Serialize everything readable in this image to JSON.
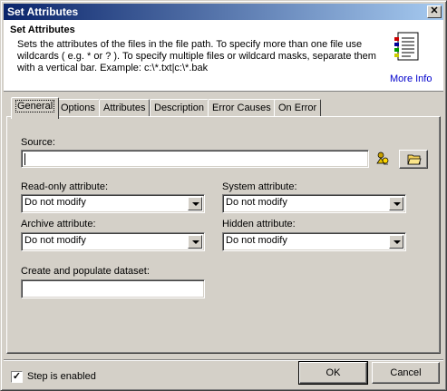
{
  "window": {
    "title": "Set Attributes",
    "close_glyph": "✕"
  },
  "header": {
    "title": "Set Attributes",
    "description": "Sets the attributes of the files in the file path. To specify more than one file use wildcards ( e.g. * or ? ). To specify multiple files or wildcard masks, separate them with a vertical bar. Example: c:\\*.txt|c:\\*.bak",
    "more_info": "More Info",
    "icon": "document-icon"
  },
  "tabs": [
    {
      "label": "General",
      "active": true
    },
    {
      "label": "Options"
    },
    {
      "label": "Attributes"
    },
    {
      "label": "Description"
    },
    {
      "label": "Error Causes"
    },
    {
      "label": "On Error"
    }
  ],
  "general": {
    "source_label": "Source:",
    "source_value": "",
    "readonly_label": "Read-only attribute:",
    "readonly_value": "Do not modify",
    "system_label": "System attribute:",
    "system_value": "Do not modify",
    "archive_label": "Archive attribute:",
    "archive_value": "Do not modify",
    "hidden_label": "Hidden attribute:",
    "hidden_value": "Do not modify",
    "dataset_label": "Create and populate dataset:",
    "dataset_value": ""
  },
  "footer": {
    "step_enabled_label": "Step is enabled",
    "step_enabled_checked": true,
    "ok_label": "OK",
    "cancel_label": "Cancel"
  }
}
